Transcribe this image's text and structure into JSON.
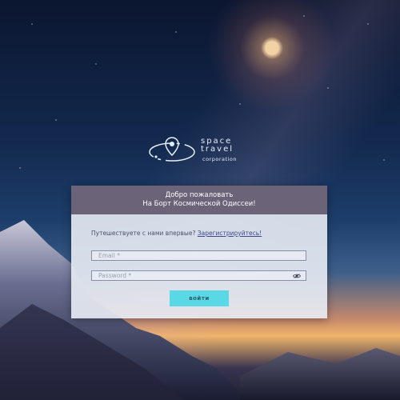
{
  "logo": {
    "line1": "space",
    "line2": "travel",
    "line3": "corporation"
  },
  "header": {
    "title_line1": "Добро пожаловать",
    "title_line2": "На Борт Космической Одиссеи!"
  },
  "register": {
    "prompt": "Путешествуете с нами впервые?",
    "link": "Зарегистрируйтесь!"
  },
  "email": {
    "placeholder": "Email *",
    "value": ""
  },
  "password": {
    "placeholder": "Password *",
    "value": "",
    "toggle_icon": "eye-icon"
  },
  "login_button": {
    "label": "войти"
  },
  "colors": {
    "header_bg": "#6b6378",
    "button_bg": "#5ad8e6",
    "card_bg": "#e8ecf4"
  }
}
